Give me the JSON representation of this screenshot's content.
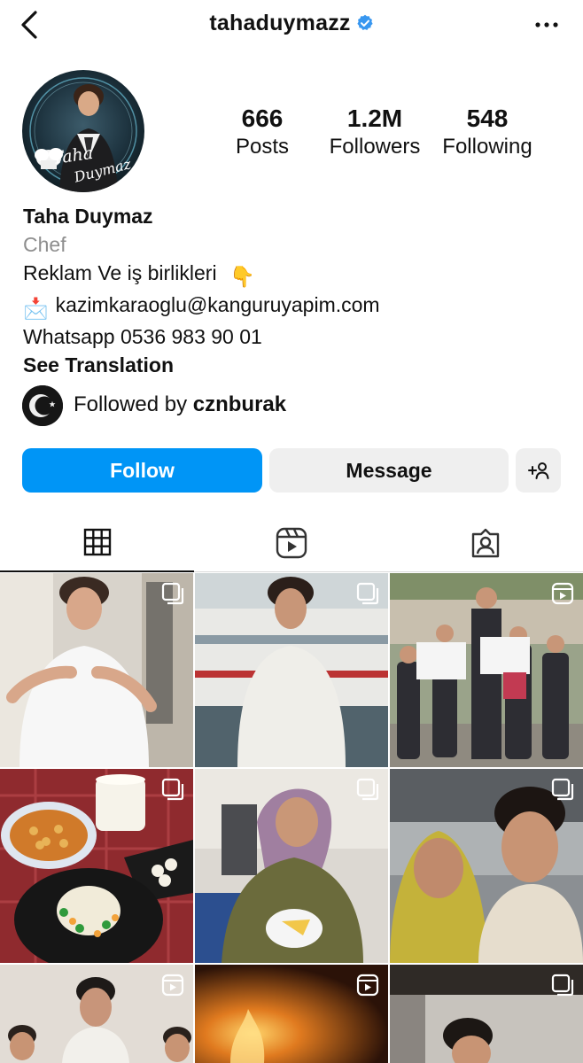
{
  "header": {
    "username": "tahaduymazz",
    "back_icon": "chevron-left-icon",
    "verified_icon": "verified-badge-icon",
    "more_icon": "more-dots-icon"
  },
  "stats": {
    "posts_value": "666",
    "posts_label": "Posts",
    "followers_value": "1.2M",
    "followers_label": "Followers",
    "following_value": "548",
    "following_label": "Following"
  },
  "avatar": {
    "logo_text_1": "Taha",
    "logo_text_2": "Duymaz"
  },
  "bio": {
    "name": "Taha Duymaz",
    "category": "Chef",
    "line1": "Reklam Ve iş birlikleri",
    "line1_emoji": "👇",
    "email_emoji": "📩",
    "email": "kazimkaraoglu@kanguruyapim.com",
    "phone": "Whatsapp 0536 983 90 01",
    "see_translation": "See Translation"
  },
  "followed_by": {
    "prefix": "Followed by",
    "user": "cznburak"
  },
  "actions": {
    "follow_label": "Follow",
    "message_label": "Message",
    "add_user_icon": "add-user-icon"
  },
  "tabs": [
    {
      "icon": "grid-icon",
      "active": true
    },
    {
      "icon": "reels-icon",
      "active": false
    },
    {
      "icon": "tagged-icon",
      "active": false
    }
  ],
  "posts": [
    {
      "type": "carousel"
    },
    {
      "type": "carousel"
    },
    {
      "type": "reel"
    },
    {
      "type": "carousel"
    },
    {
      "type": "carousel"
    },
    {
      "type": "carousel"
    },
    {
      "type": "reel"
    },
    {
      "type": "reel"
    },
    {
      "type": "carousel"
    }
  ],
  "colors": {
    "accent": "#0095f6",
    "secondary_button": "#efefef",
    "muted_text": "#8e8e8e",
    "verified": "#3897f0"
  }
}
